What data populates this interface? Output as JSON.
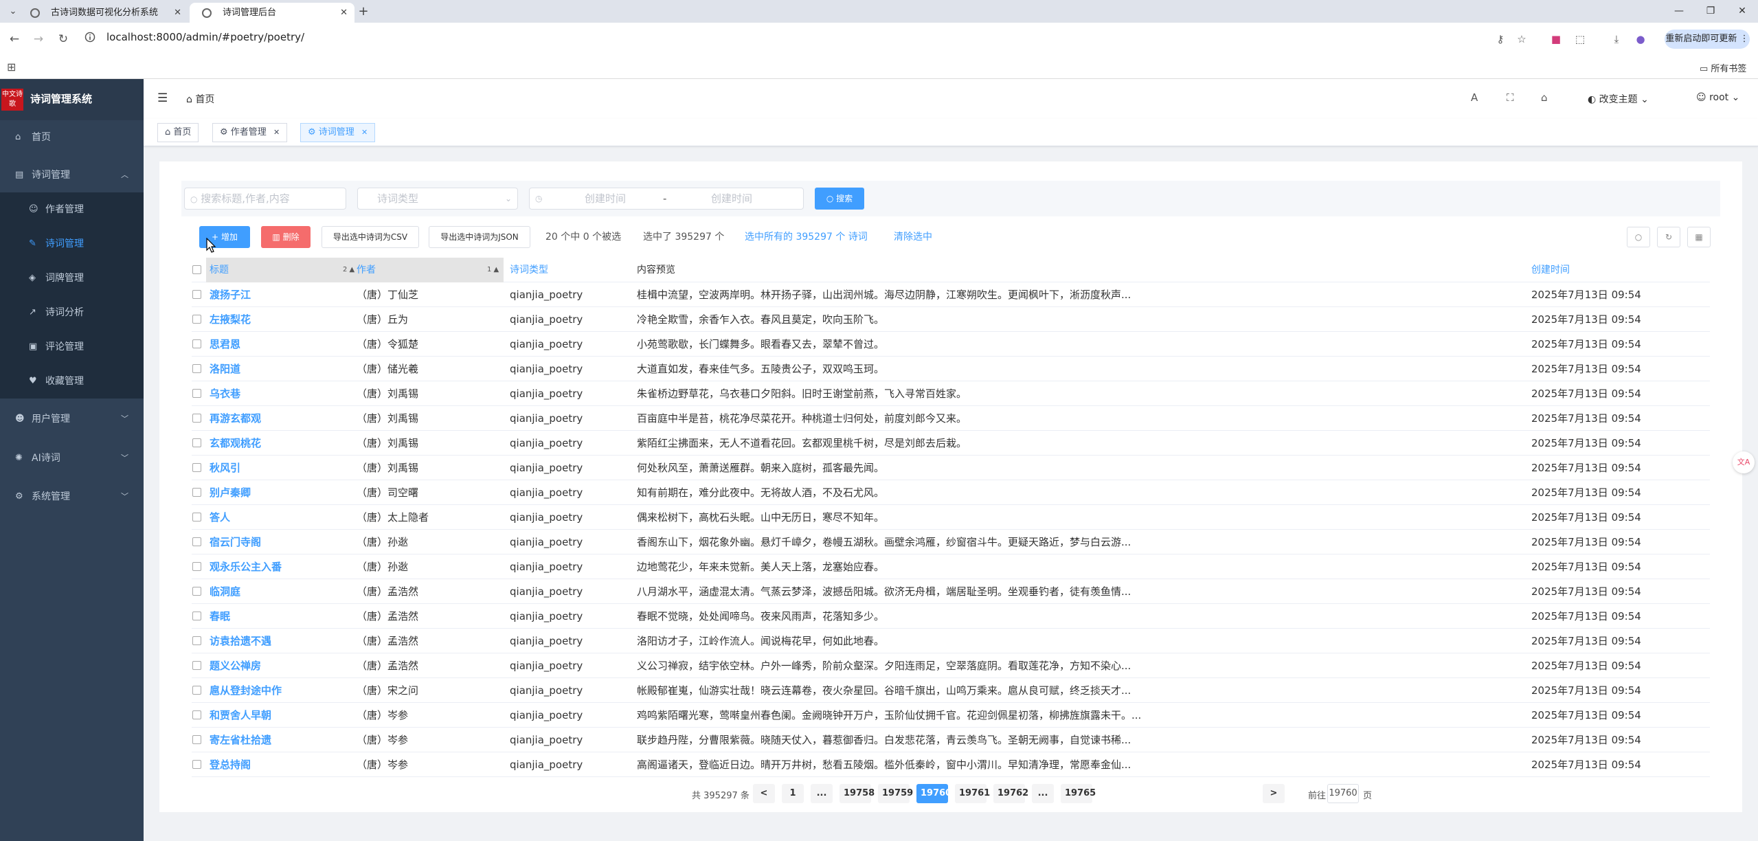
{
  "browser": {
    "tabs": [
      {
        "title": "古诗词数据可视化分析系统"
      },
      {
        "title": "诗词管理后台"
      }
    ],
    "url": "localhost:8000/admin/#poetry/poetry/",
    "update_label": "重新启动即可更新",
    "bookmarks_label": "所有书签"
  },
  "sidebar": {
    "logo_text": "中文诗歌",
    "title": "诗词管理系统",
    "items": [
      {
        "label": "首页",
        "icon": "home-icon"
      },
      {
        "label": "诗词管理",
        "icon": "book-icon"
      },
      {
        "label": "作者管理",
        "icon": "user-icon"
      },
      {
        "label": "诗词管理",
        "icon": "edit-icon"
      },
      {
        "label": "词牌管理",
        "icon": "tag-icon"
      },
      {
        "label": "诗词分析",
        "icon": "chart-icon"
      },
      {
        "label": "评论管理",
        "icon": "comment-icon"
      },
      {
        "label": "收藏管理",
        "icon": "heart-icon"
      },
      {
        "label": "用户管理",
        "icon": "users-icon"
      },
      {
        "label": "AI诗词",
        "icon": "brain-icon"
      },
      {
        "label": "系统管理",
        "icon": "gear-icon"
      }
    ]
  },
  "header": {
    "breadcrumb": "首页",
    "theme_label": "改变主题",
    "user": "root"
  },
  "tags": [
    {
      "label": "首页"
    },
    {
      "label": "作者管理"
    },
    {
      "label": "诗词管理"
    }
  ],
  "filters": {
    "search_placeholder": "搜索标题,作者,内容",
    "type_placeholder": "诗词类型",
    "start_placeholder": "创建时间",
    "date_sep": "-",
    "end_placeholder": "创建时间",
    "search_label": "搜索"
  },
  "actions": {
    "add_label": "增加",
    "delete_label": "删除",
    "export_csv_label": "导出选中诗词为CSV",
    "export_json_label": "导出选中诗词为JSON",
    "selected_count": "20 个中 0 个被选",
    "selected_total": "选中了 395297 个",
    "select_all_link": "选中所有的 395297 个 诗词",
    "clear_link": "清除选中"
  },
  "table": {
    "headers": {
      "title": "标题",
      "title_sort": "2",
      "author": "作者",
      "author_sort": "1",
      "type": "诗词类型",
      "preview": "内容预览",
      "created": "创建时间"
    },
    "rows": [
      {
        "title": "渡扬子江",
        "author": "（唐）丁仙芝",
        "type": "qianjia_poetry",
        "preview": "桂楫中流望，空波两岸明。林开扬子驿，山出润州城。海尽边阴静，江寒朔吹生。更闻枫叶下，淅沥度秋声...",
        "created": "2025年7月13日 09:54"
      },
      {
        "title": "左掖梨花",
        "author": "（唐）丘为",
        "type": "qianjia_poetry",
        "preview": "冷艳全欺雪，余香乍入衣。春风且莫定，吹向玉阶飞。",
        "created": "2025年7月13日 09:54"
      },
      {
        "title": "思君恩",
        "author": "（唐）令狐楚",
        "type": "qianjia_poetry",
        "preview": "小苑莺歌歇，长门蝶舞多。眼看春又去，翠辇不曾过。",
        "created": "2025年7月13日 09:54"
      },
      {
        "title": "洛阳道",
        "author": "（唐）储光羲",
        "type": "qianjia_poetry",
        "preview": "大道直如发，春来佳气多。五陵贵公子，双双鸣玉珂。",
        "created": "2025年7月13日 09:54"
      },
      {
        "title": "乌衣巷",
        "author": "（唐）刘禹锡",
        "type": "qianjia_poetry",
        "preview": "朱雀桥边野草花，乌衣巷口夕阳斜。旧时王谢堂前燕，飞入寻常百姓家。",
        "created": "2025年7月13日 09:54"
      },
      {
        "title": "再游玄都观",
        "author": "（唐）刘禹锡",
        "type": "qianjia_poetry",
        "preview": "百亩庭中半是苔，桃花净尽菜花开。种桃道士归何处，前度刘郎今又来。",
        "created": "2025年7月13日 09:54"
      },
      {
        "title": "玄都观桃花",
        "author": "（唐）刘禹锡",
        "type": "qianjia_poetry",
        "preview": "紫陌红尘拂面来，无人不道看花回。玄都观里桃千树，尽是刘郎去后栽。",
        "created": "2025年7月13日 09:54"
      },
      {
        "title": "秋风引",
        "author": "（唐）刘禹锡",
        "type": "qianjia_poetry",
        "preview": "何处秋风至，萧萧送雁群。朝来入庭树，孤客最先闻。",
        "created": "2025年7月13日 09:54"
      },
      {
        "title": "别卢秦卿",
        "author": "（唐）司空曙",
        "type": "qianjia_poetry",
        "preview": "知有前期在，难分此夜中。无将故人酒，不及石尤风。",
        "created": "2025年7月13日 09:54"
      },
      {
        "title": "答人",
        "author": "（唐）太上隐者",
        "type": "qianjia_poetry",
        "preview": "偶来松树下，高枕石头眠。山中无历日，寒尽不知年。",
        "created": "2025年7月13日 09:54"
      },
      {
        "title": "宿云门寺阁",
        "author": "（唐）孙逖",
        "type": "qianjia_poetry",
        "preview": "香阁东山下，烟花象外幽。悬灯千嶂夕，卷幔五湖秋。画壁余鸿雁，纱窗宿斗牛。更疑天路近，梦与白云游...",
        "created": "2025年7月13日 09:54"
      },
      {
        "title": "观永乐公主入番",
        "author": "（唐）孙逖",
        "type": "qianjia_poetry",
        "preview": "边地莺花少，年来未觉新。美人天上落，龙塞始应春。",
        "created": "2025年7月13日 09:54"
      },
      {
        "title": "临洞庭",
        "author": "（唐）孟浩然",
        "type": "qianjia_poetry",
        "preview": "八月湖水平，涵虚混太清。气蒸云梦泽，波撼岳阳城。欲济无舟楫，端居耻圣明。坐观垂钓者，徒有羡鱼情...",
        "created": "2025年7月13日 09:54"
      },
      {
        "title": "春眠",
        "author": "（唐）孟浩然",
        "type": "qianjia_poetry",
        "preview": "春眠不觉晓，处处闻啼鸟。夜来风雨声，花落知多少。",
        "created": "2025年7月13日 09:54"
      },
      {
        "title": "访袁拾遗不遇",
        "author": "（唐）孟浩然",
        "type": "qianjia_poetry",
        "preview": "洛阳访才子，江岭作流人。闻说梅花早，何如此地春。",
        "created": "2025年7月13日 09:54"
      },
      {
        "title": "题义公禅房",
        "author": "（唐）孟浩然",
        "type": "qianjia_poetry",
        "preview": "义公习禅寂，结宇依空林。户外一峰秀，阶前众壑深。夕阳连雨足，空翠落庭阴。看取莲花净，方知不染心...",
        "created": "2025年7月13日 09:54"
      },
      {
        "title": "扈从登封途中作",
        "author": "（唐）宋之问",
        "type": "qianjia_poetry",
        "preview": "帐殿郁崔嵬，仙游实壮哉！晓云连幕卷，夜火杂星回。谷暗千旗出，山鸣万乘来。扈从良可赋，终乏掞天才...",
        "created": "2025年7月13日 09:54"
      },
      {
        "title": "和贾舍人早朝",
        "author": "（唐）岑参",
        "type": "qianjia_poetry",
        "preview": "鸡鸣紫陌曙光寒，莺啭皇州春色阑。金阙晓钟开万户，玉阶仙仗拥千官。花迎剑佩星初落，柳拂旌旗露未干。...",
        "created": "2025年7月13日 09:54"
      },
      {
        "title": "寄左省杜拾遗",
        "author": "（唐）岑参",
        "type": "qianjia_poetry",
        "preview": "联步趋丹陛，分曹限紫薇。晓随天仗入，暮惹御香归。白发悲花落，青云羡鸟飞。圣朝无阙事，自觉谏书稀...",
        "created": "2025年7月13日 09:54"
      },
      {
        "title": "登总持阁",
        "author": "（唐）岑参",
        "type": "qianjia_poetry",
        "preview": "高阁逼诸天，登临近日边。晴开万井树，愁看五陵烟。槛外低秦岭，窗中小渭川。早知清净理，常愿奉金仙...",
        "created": "2025年7月13日 09:54"
      }
    ]
  },
  "pagination": {
    "total": "共 395297 条",
    "prev": "<",
    "pages": [
      "1",
      "...",
      "19758",
      "19759",
      "19760",
      "19761",
      "19762",
      "...",
      "19765"
    ],
    "active": "19760",
    "next": ">",
    "goto_prefix": "前往",
    "goto_value": "19760",
    "goto_suffix": "页"
  },
  "colors": {
    "primary": "#409eff",
    "danger": "#f56c6c",
    "sidebar": "#304156"
  },
  "float_badge": "文A"
}
